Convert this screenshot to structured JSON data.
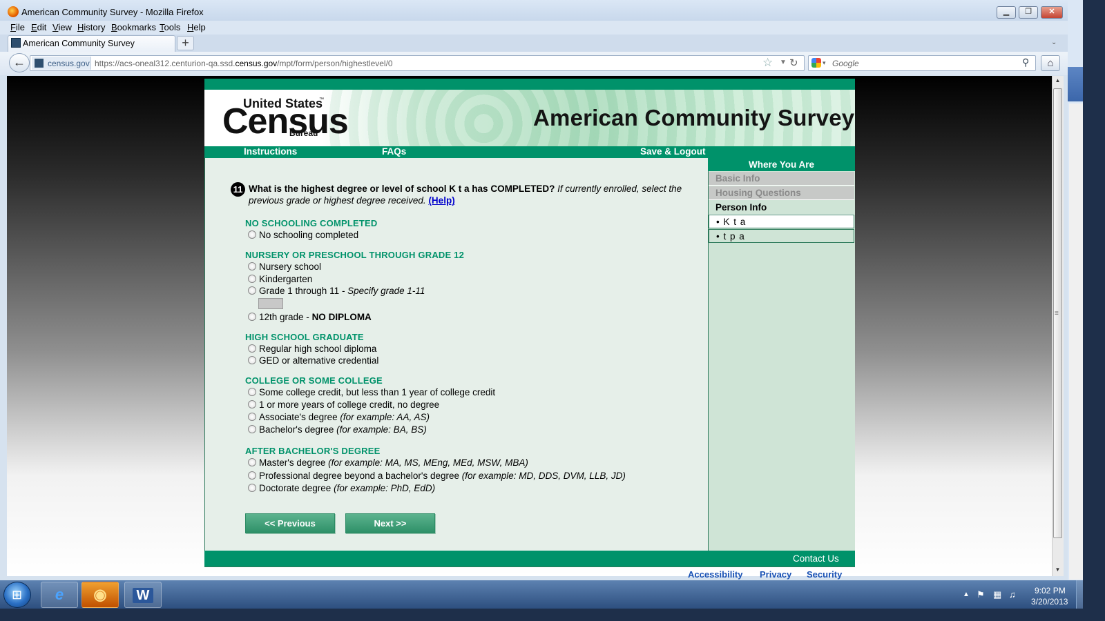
{
  "window": {
    "title": "American Community Survey - Mozilla Firefox",
    "controls": {
      "minimize": "▁",
      "maximize": "❐",
      "close": "✕"
    }
  },
  "menubar": {
    "items": [
      {
        "accel": "F",
        "rest": "ile"
      },
      {
        "accel": "E",
        "rest": "dit"
      },
      {
        "accel": "V",
        "rest": "iew"
      },
      {
        "accel": "H",
        "rest": "istory"
      },
      {
        "accel": "B",
        "rest": "ookmarks"
      },
      {
        "accel": "T",
        "rest": "ools"
      },
      {
        "accel": "H",
        "rest": "elp"
      }
    ]
  },
  "tabs": {
    "active_label": "American Community Survey",
    "new_tab": "+",
    "list_icon": "⌄"
  },
  "navbar": {
    "back": "←",
    "site_name": "census.gov",
    "url_pre": "https://acs-oneal312.centurion-qa.ssd.",
    "url_domain": "census.gov",
    "url_post": "/mpt/form/person/highestlevel/0",
    "search_placeholder": "Google",
    "icons": {
      "star": "☆",
      "dropdown": "▼",
      "reload": "↻",
      "search": "⚲",
      "home": "⌂",
      "search_drop": "▾"
    }
  },
  "scrollbar": {
    "up": "▲",
    "down": "▼",
    "grip": "≡"
  },
  "banner": {
    "agency_line1": "United States",
    "agency_tm": "™",
    "agency_main": "Census",
    "agency_line3": "Bureau",
    "survey_title": "American Community Survey"
  },
  "topnav": {
    "instructions": "Instructions",
    "faqs": "FAQs",
    "save_logout": "Save & Logout"
  },
  "sidebar": {
    "heading": "Where You Are",
    "sections": {
      "basic": "Basic Info",
      "housing": "Housing Questions",
      "person": "Person Info"
    },
    "people": [
      "• K t a",
      "• t p a"
    ]
  },
  "question": {
    "number": "11",
    "bold": "What is the highest degree or level of school K t a has COMPLETED?",
    "italic": " If currently enrolled, select the previous grade or highest degree received.",
    "help": "(Help)"
  },
  "sections": {
    "none": {
      "heading": "NO SCHOOLING COMPLETED",
      "options": [
        {
          "label": "No schooling completed"
        }
      ]
    },
    "nursery": {
      "heading": "NURSERY OR PRESCHOOL THROUGH GRADE 12",
      "options": [
        {
          "label": "Nursery school"
        },
        {
          "label": "Kindergarten"
        },
        {
          "label": "Grade 1 through 11",
          "hint": " - Specify grade 1-11"
        },
        {
          "label": "12th grade - ",
          "strong": "NO DIPLOMA"
        }
      ],
      "grade_input_value": ""
    },
    "highschool": {
      "heading": "HIGH SCHOOL GRADUATE",
      "options": [
        {
          "label": "Regular high school diploma"
        },
        {
          "label": "GED or alternative credential"
        }
      ]
    },
    "college": {
      "heading": "COLLEGE OR SOME COLLEGE",
      "options": [
        {
          "label": "Some college credit, but less than 1 year of college credit"
        },
        {
          "label": "1 or more years of college credit, no degree"
        },
        {
          "label": "Associate's degree ",
          "hint": "(for example: AA, AS)"
        },
        {
          "label": "Bachelor's degree ",
          "hint": "(for example: BA, BS)"
        }
      ]
    },
    "graduate": {
      "heading": "AFTER BACHELOR'S DEGREE",
      "options": [
        {
          "label": "Master's degree ",
          "hint": "(for example: MA, MS, MEng, MEd, MSW, MBA)"
        },
        {
          "label": "Professional degree beyond a bachelor's degree ",
          "hint": "(for example: MD, DDS, DVM, LLB, JD)"
        },
        {
          "label": "Doctorate degree ",
          "hint": "(for example: PhD, EdD)"
        }
      ]
    }
  },
  "buttons": {
    "previous": "<<   Previous",
    "next": "Next   >>"
  },
  "footer": {
    "contact": "Contact Us",
    "accessibility": "Accessibility",
    "privacy": "Privacy",
    "security": "Security"
  },
  "taskbar": {
    "start_icon": "windows-start",
    "apps": {
      "ie": "e",
      "firefox": "◉",
      "word": "W"
    },
    "tray": {
      "arrow": "▲",
      "flag": "⚑",
      "network": "▦",
      "volume": "♫"
    },
    "time": "9:02 PM",
    "date": "3/20/2013"
  },
  "colors": {
    "census_green": "#00926a",
    "page_bg": "#e6efe9",
    "link_blue": "#0000cc"
  }
}
